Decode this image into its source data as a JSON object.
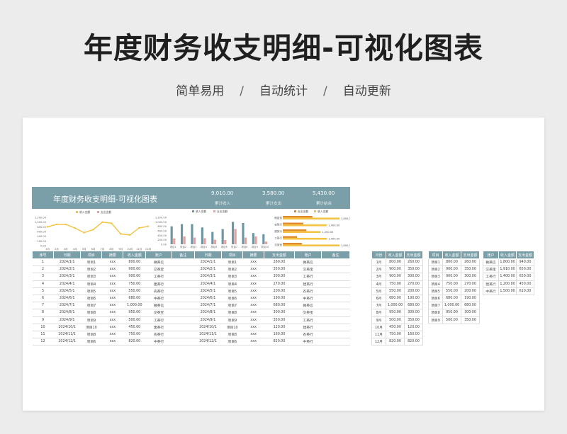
{
  "header": {
    "title": "年度财务收支明细-可视化图表",
    "tags": [
      "简单易用",
      "自动统计",
      "自动更新"
    ],
    "separator": "/"
  },
  "sheet": {
    "title": "年度财务收支明细-可视化图表",
    "stats": [
      {
        "value": "9,010.00",
        "label": "累计收入"
      },
      {
        "value": "3,580.00",
        "label": "累计支出"
      },
      {
        "value": "5,430.00",
        "label": "累计结余"
      }
    ],
    "colors": {
      "accent": "#7a9fa8",
      "income": "#f5c342",
      "expense": "#e8a0a0",
      "bar_income": "#6c97a4",
      "bar_hbar1": "#e08a2a",
      "bar_hbar2": "#f5c342"
    }
  },
  "chart_data": [
    {
      "type": "line",
      "series": [
        {
          "name": "收入金额",
          "values": [
            800,
            900,
            900,
            750,
            550,
            680,
            1000,
            950,
            500,
            450,
            750,
            820
          ]
        },
        {
          "name": "支出金额",
          "values": [
            260,
            350,
            300,
            270,
            200,
            190,
            680,
            300,
            350,
            120,
            160,
            820
          ]
        }
      ],
      "categories": [
        "1月",
        "2月",
        "3月",
        "4月",
        "5月",
        "6月",
        "7月",
        "8月",
        "9月",
        "10月",
        "11月",
        "12月"
      ],
      "yticks": [
        "1,200.00",
        "1,000.00",
        "800.00",
        "600.00",
        "400.00",
        "200.00",
        "0.00"
      ],
      "ylim": [
        0,
        1200
      ]
    },
    {
      "type": "bar",
      "series": [
        {
          "name": "收入金额",
          "values": [
            800,
            900,
            900,
            750,
            550,
            680,
            1000,
            950,
            500,
            450
          ]
        },
        {
          "name": "支出金额",
          "values": [
            260,
            350,
            300,
            270,
            200,
            190,
            680,
            300,
            350,
            120
          ]
        }
      ],
      "categories": [
        "项目1",
        "项目2",
        "项目3",
        "项目4",
        "项目5",
        "项目6",
        "项目7",
        "项目8",
        "项目9",
        "项目10"
      ],
      "yticks": [
        "1,200.00",
        "1,000.00",
        "800.00",
        "600.00",
        "400.00",
        "200.00",
        "0.00"
      ],
      "ylim": [
        0,
        1200
      ]
    },
    {
      "type": "bar",
      "orientation": "horizontal",
      "series": [
        {
          "name": "支出金额",
          "values": [
            940,
            650,
            750,
            450,
            610
          ]
        },
        {
          "name": "收入金额",
          "values": [
            1800,
            1400,
            1200,
            1400,
            1800
          ]
        }
      ],
      "categories": [
        "微富信",
        "农英行",
        "建英行",
        "工英行",
        "交英宝"
      ],
      "value_labels": [
        "1,800.00",
        "1,400.00",
        "1,200.00",
        "1,400.00",
        "1,800.00"
      ]
    }
  ],
  "table": {
    "headers": [
      "序号",
      "日期",
      "项目",
      "摘要",
      "收入金额",
      "账户",
      "备注",
      "日期",
      "项目",
      "摘要",
      "支出金额",
      "账户",
      "备注"
    ],
    "rows": [
      [
        "1",
        "2024/1/1",
        "项目1",
        "xxx",
        "800.00",
        "微英信",
        "",
        "2024/1/1",
        "项目1",
        "xxx",
        "260.00",
        "微英信",
        ""
      ],
      [
        "2",
        "2024/2/1",
        "项目2",
        "xxx",
        "900.00",
        "交英宝",
        "",
        "2024/2/1",
        "项目2",
        "xxx",
        "350.00",
        "交英宝",
        ""
      ],
      [
        "3",
        "2024/3/1",
        "项目3",
        "xxx",
        "900.00",
        "工英行",
        "",
        "2024/3/1",
        "项目3",
        "xxx",
        "300.00",
        "工英行",
        ""
      ],
      [
        "4",
        "2024/4/1",
        "项目4",
        "xxx",
        "750.00",
        "建英行",
        "",
        "2024/4/1",
        "项目4",
        "xxx",
        "270.00",
        "建英行",
        ""
      ],
      [
        "5",
        "2024/5/1",
        "项目5",
        "xxx",
        "550.00",
        "农英行",
        "",
        "2024/5/1",
        "项目5",
        "xxx",
        "200.00",
        "农英行",
        ""
      ],
      [
        "6",
        "2024/6/1",
        "项目6",
        "xxx",
        "680.00",
        "中英行",
        "",
        "2024/6/1",
        "项目6",
        "xxx",
        "190.00",
        "中英行",
        ""
      ],
      [
        "7",
        "2024/7/1",
        "项目7",
        "xxx",
        "1,000.00",
        "微英信",
        "",
        "2024/7/1",
        "项目7",
        "xxx",
        "680.00",
        "微英信",
        ""
      ],
      [
        "8",
        "2024/8/1",
        "项目8",
        "xxx",
        "950.00",
        "交英宝",
        "",
        "2024/8/1",
        "项目8",
        "xxx",
        "300.00",
        "交英宝",
        ""
      ],
      [
        "9",
        "2024/9/1",
        "项目9",
        "xxx",
        "500.00",
        "工英行",
        "",
        "2024/9/1",
        "项目9",
        "xxx",
        "350.00",
        "工英行",
        ""
      ],
      [
        "10",
        "2024/10/1",
        "项目10",
        "xxx",
        "450.00",
        "建英行",
        "",
        "2024/10/1",
        "项目10",
        "xxx",
        "120.00",
        "建英行",
        ""
      ],
      [
        "11",
        "2024/11/1",
        "项目8",
        "xxx",
        "750.00",
        "农英行",
        "",
        "2024/11/1",
        "项目8",
        "xxx",
        "160.00",
        "农英行",
        ""
      ],
      [
        "12",
        "2024/12/1",
        "项目6",
        "xxx",
        "820.00",
        "中英行",
        "",
        "2024/12/1",
        "项目6",
        "xxx",
        "820.00",
        "中英行",
        ""
      ]
    ]
  },
  "month_table": {
    "headers": [
      "月份",
      "收入金额",
      "支出金额"
    ],
    "rows": [
      [
        "1月",
        "800.00",
        "260.00"
      ],
      [
        "2月",
        "900.00",
        "350.00"
      ],
      [
        "3月",
        "900.00",
        "300.00"
      ],
      [
        "4月",
        "750.00",
        "270.00"
      ],
      [
        "5月",
        "550.00",
        "200.00"
      ],
      [
        "6月",
        "680.00",
        "190.00"
      ],
      [
        "7月",
        "1,000.00",
        "680.00"
      ],
      [
        "8月",
        "950.00",
        "300.00"
      ],
      [
        "9月",
        "500.00",
        "350.00"
      ],
      [
        "10月",
        "450.00",
        "120.00"
      ],
      [
        "11月",
        "750.00",
        "160.00"
      ],
      [
        "12月",
        "820.00",
        "820.00"
      ]
    ]
  },
  "project_table": {
    "headers": [
      "项目",
      "收入金额",
      "支出金额"
    ],
    "rows": [
      [
        "项目1",
        "800.00",
        "260.00"
      ],
      [
        "项目2",
        "900.00",
        "350.00"
      ],
      [
        "项目3",
        "900.00",
        "300.00"
      ],
      [
        "项目4",
        "750.00",
        "270.00"
      ],
      [
        "项目5",
        "550.00",
        "200.00"
      ],
      [
        "项目6",
        "680.00",
        "190.00"
      ],
      [
        "项目7",
        "1,000.00",
        "680.00"
      ],
      [
        "项目8",
        "950.00",
        "300.00"
      ],
      [
        "项目9",
        "500.00",
        "350.00"
      ]
    ]
  },
  "account_table": {
    "headers": [
      "账户",
      "收入金额",
      "支出金额"
    ],
    "rows": [
      [
        "微英信",
        "1,800.00",
        "940.00"
      ],
      [
        "交英宝",
        "1,910.00",
        "650.00"
      ],
      [
        "工英行",
        "1,400.00",
        "650.00"
      ],
      [
        "建英行",
        "1,200.00",
        "450.00"
      ],
      [
        "中英行",
        "1,500.00",
        "610.00"
      ]
    ]
  }
}
